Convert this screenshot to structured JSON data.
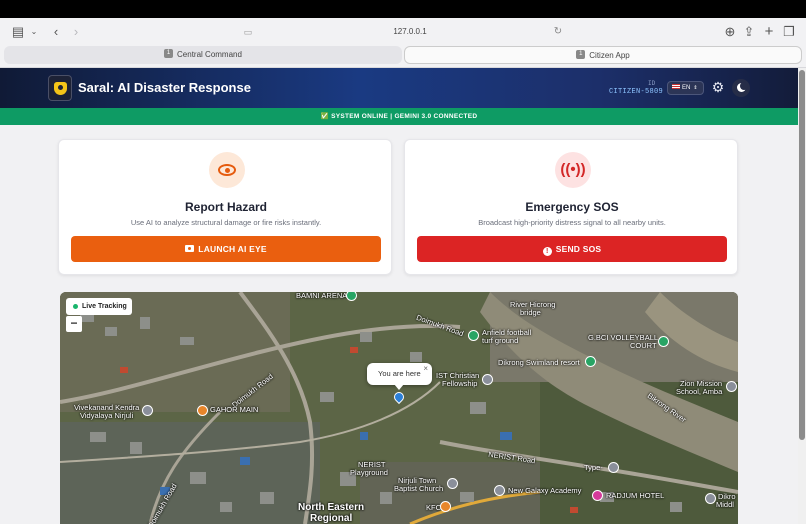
{
  "browser": {
    "address": "127.0.0.1",
    "tabs": [
      {
        "num": "1",
        "label": "Central Command"
      },
      {
        "num": "1",
        "label": "Citizen App"
      }
    ]
  },
  "header": {
    "title": "Saral: AI Disaster Response",
    "id_label": "ID",
    "citizen_id": "CITIZEN-5809",
    "language": "EN"
  },
  "status": {
    "text": "✅ SYSTEM ONLINE | GEMINI 3.0 CONNECTED"
  },
  "cards": {
    "report": {
      "title": "Report Hazard",
      "description": "Use AI to analyze structural damage or fire risks instantly.",
      "button": "LAUNCH AI EYE"
    },
    "sos": {
      "title": "Emergency SOS",
      "description": "Broadcast high-priority distress signal to all nearby units.",
      "button": "SEND SOS"
    }
  },
  "map": {
    "live_label": "Live Tracking",
    "zoom_out": "−",
    "popup": "You are here",
    "popup_close": "×",
    "labels": {
      "l1": "BAMNI ARENA",
      "l2": "River Hicrong",
      "l3": "bridge",
      "l4": "Doimukh Road",
      "l5": "Anfield football",
      "l6": "turf ground",
      "l7": "G.BCI VOLLEYBALL",
      "l8": "COURT",
      "l9": "Dikrong Swimland resort",
      "l10": "IST Christian",
      "l11": "Fellowship",
      "l12": "Zion Mission",
      "l13": "School, Amba",
      "l14": "Doimukh Road",
      "l15": "Vivekanand Kendra",
      "l16": "Vidyalaya Nirjuli",
      "l17": "GAHOR MAIN",
      "l18": "NERIST Road",
      "l19": "NERIST",
      "l20": "Playground",
      "l21": "Nirjuli Town",
      "l22": "Baptist Church",
      "l23": "New Galaxy Academy",
      "l24": "RADJUM HOTEL",
      "l25": "Type-",
      "l26": "North Eastern",
      "l27": "Regional",
      "l28": "KFC",
      "l29": "Dikro",
      "l30": "Middl",
      "l31": "Doimukh Road",
      "l32": "Bikrong River"
    }
  },
  "colors": {
    "header_start": "#101a36",
    "header_mid": "#1a3a82",
    "status_green": "#0e9b64",
    "report_orange": "#ea5f0f",
    "sos_red": "#dc2424"
  }
}
